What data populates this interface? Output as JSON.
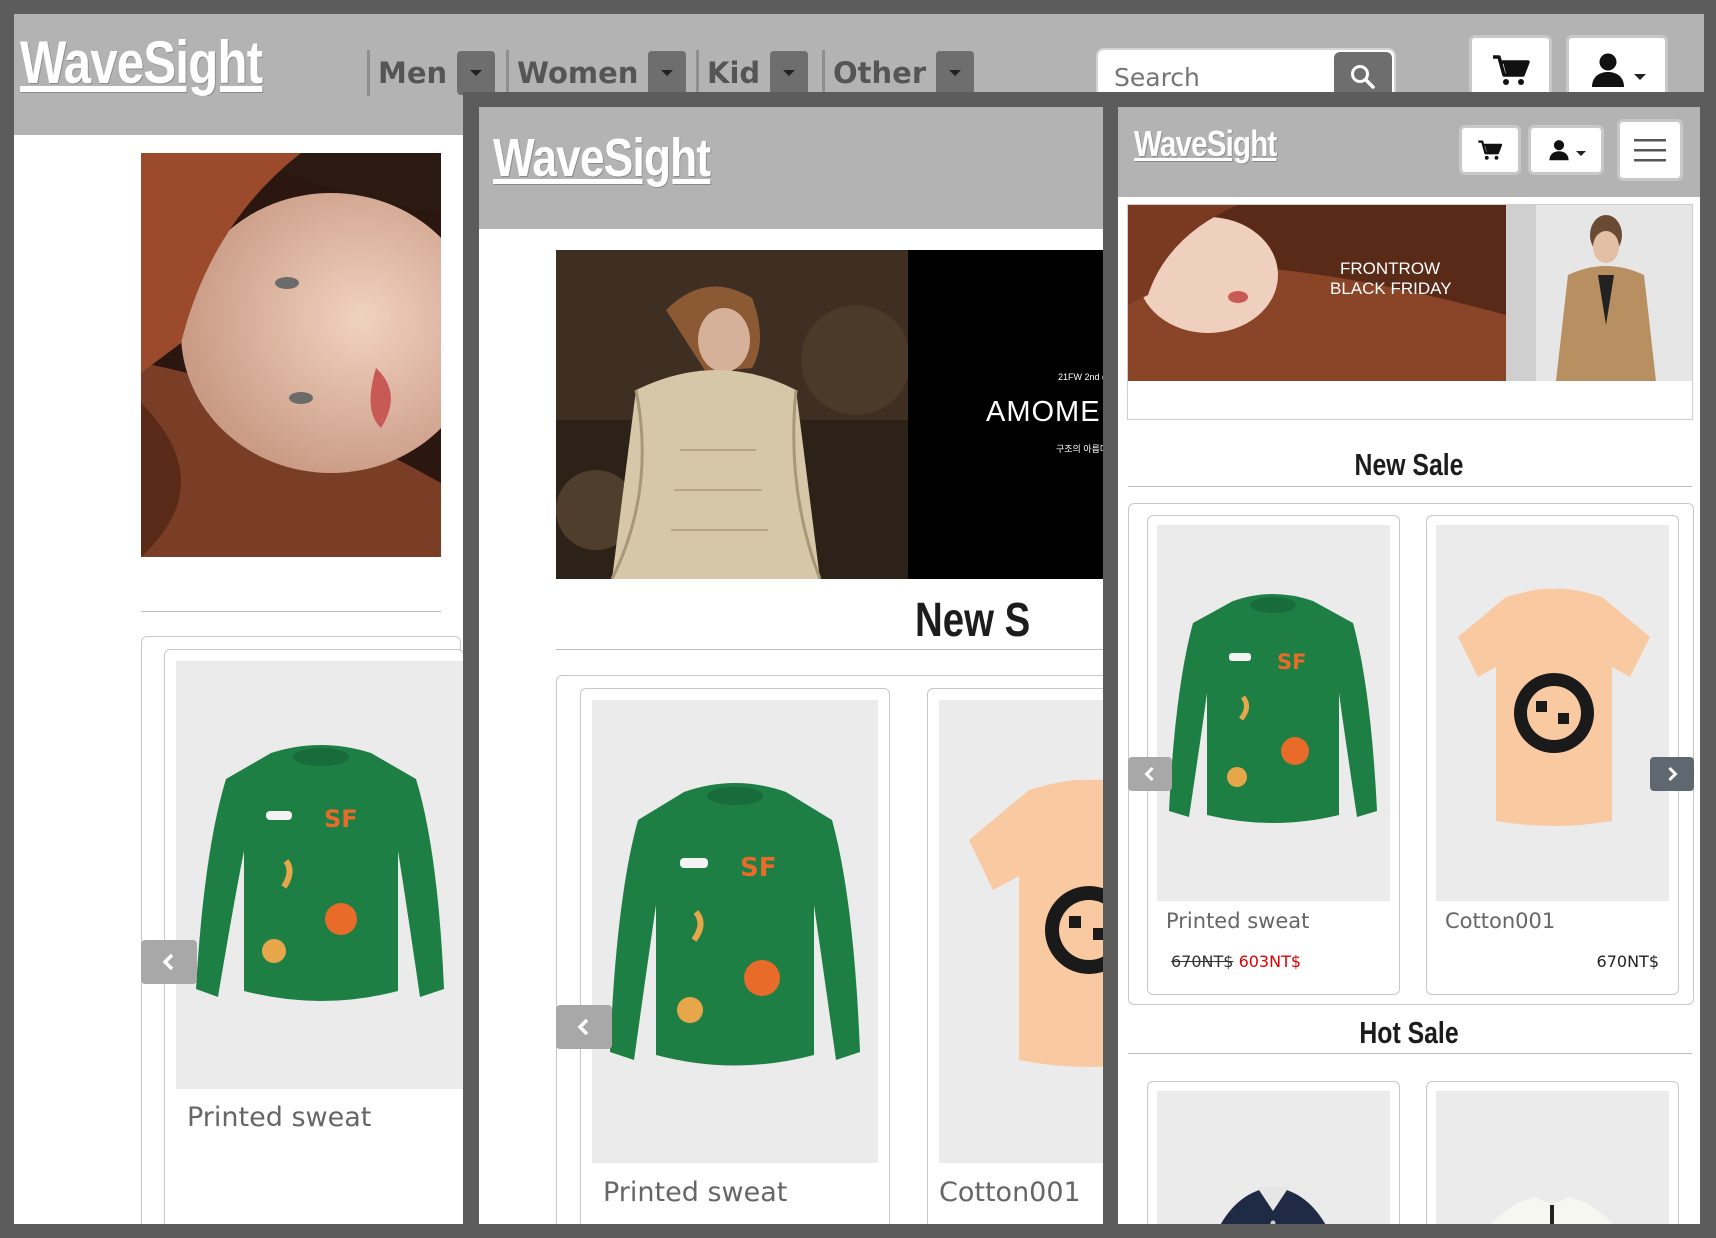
{
  "brand": {
    "logo_text": "WaveSight"
  },
  "desktop": {
    "nav": [
      {
        "label": "Men"
      },
      {
        "label": "Women"
      },
      {
        "label": "Kid"
      },
      {
        "label": "Other"
      }
    ],
    "search": {
      "placeholder": "Search"
    },
    "products": [
      {
        "title": "Printed sweat"
      }
    ]
  },
  "tablet": {
    "banner": {
      "tag": "21FW 2nd dr",
      "headline": "AMOME",
      "sub": "구조의 아름다"
    },
    "section_title": "New S",
    "products": [
      {
        "title": "Printed sweat"
      },
      {
        "title": "Cotton001"
      }
    ]
  },
  "mobile": {
    "banner": {
      "line1": "FRONTROW",
      "line2": "BLACK FRIDAY"
    },
    "sections": [
      {
        "title": "New Sale",
        "products": [
          {
            "title": "Printed sweat",
            "old_price": "670NT$",
            "price": "603NT$"
          },
          {
            "title": "Cotton001",
            "price": "670NT$"
          }
        ]
      },
      {
        "title": "Hot Sale"
      }
    ]
  },
  "colors": {
    "header": "#b3b3b3",
    "background": "#5c5c5c",
    "sweater_green": "#1e7f45",
    "tee_peach": "#f9c9a2",
    "sale_red": "#e00000"
  },
  "icons": [
    "cart-icon",
    "user-icon",
    "search-icon",
    "menu-icon",
    "chevron-left-icon",
    "chevron-right-icon",
    "caret-down-icon"
  ]
}
